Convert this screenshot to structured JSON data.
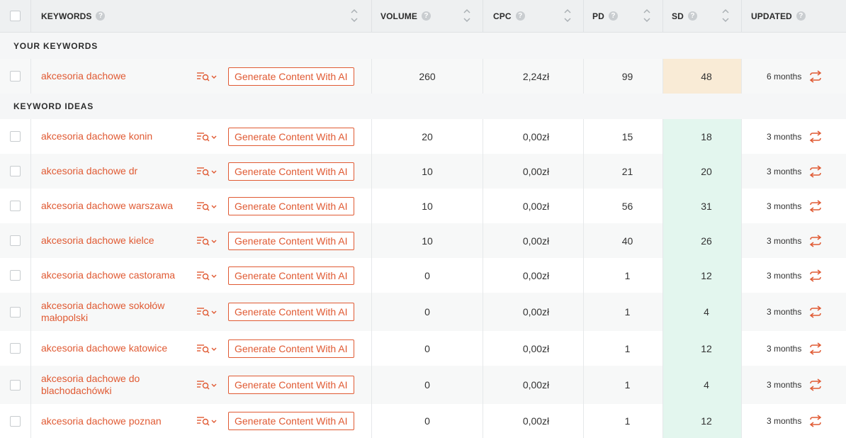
{
  "header": {
    "keywords": "KEYWORDS",
    "volume": "VOLUME",
    "cpc": "CPC",
    "pd": "PD",
    "sd": "SD",
    "updated": "UPDATED",
    "help": "?"
  },
  "sections": {
    "your_keywords": "YOUR KEYWORDS",
    "keyword_ideas": "KEYWORD IDEAS"
  },
  "button_label": "Generate Content With AI",
  "your_keyword": {
    "keyword": "akcesoria dachowe",
    "volume": "260",
    "cpc": "2,24zł",
    "pd": "99",
    "sd": "48",
    "updated": "6 months"
  },
  "ideas": [
    {
      "keyword": "akcesoria dachowe konin",
      "volume": "20",
      "cpc": "0,00zł",
      "pd": "15",
      "sd": "18",
      "updated": "3 months"
    },
    {
      "keyword": "akcesoria dachowe dr",
      "volume": "10",
      "cpc": "0,00zł",
      "pd": "21",
      "sd": "20",
      "updated": "3 months"
    },
    {
      "keyword": "akcesoria dachowe warszawa",
      "volume": "10",
      "cpc": "0,00zł",
      "pd": "56",
      "sd": "31",
      "updated": "3 months"
    },
    {
      "keyword": "akcesoria dachowe kielce",
      "volume": "10",
      "cpc": "0,00zł",
      "pd": "40",
      "sd": "26",
      "updated": "3 months"
    },
    {
      "keyword": "akcesoria dachowe castorama",
      "volume": "0",
      "cpc": "0,00zł",
      "pd": "1",
      "sd": "12",
      "updated": "3 months"
    },
    {
      "keyword": "akcesoria dachowe sokołów małopolski",
      "volume": "0",
      "cpc": "0,00zł",
      "pd": "1",
      "sd": "4",
      "updated": "3 months"
    },
    {
      "keyword": "akcesoria dachowe katowice",
      "volume": "0",
      "cpc": "0,00zł",
      "pd": "1",
      "sd": "12",
      "updated": "3 months"
    },
    {
      "keyword": "akcesoria dachowe do blachodachówki",
      "volume": "0",
      "cpc": "0,00zł",
      "pd": "1",
      "sd": "4",
      "updated": "3 months"
    },
    {
      "keyword": "akcesoria dachowe poznan",
      "volume": "0",
      "cpc": "0,00zł",
      "pd": "1",
      "sd": "12",
      "updated": "3 months"
    }
  ],
  "colors": {
    "accent": "#e05a33",
    "sd_low": "#e3f6ee",
    "sd_mid": "#f9ebd6"
  },
  "icons": {
    "row_action": "serp-search-icon",
    "refresh": "refresh-icon",
    "sort": "sort-arrows-icon"
  }
}
